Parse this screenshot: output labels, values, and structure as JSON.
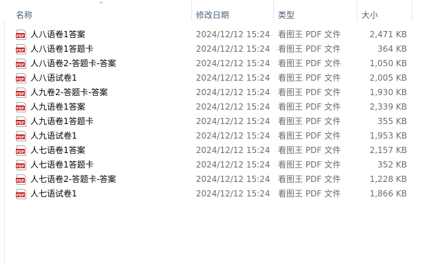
{
  "columns": {
    "name": "名称",
    "date": "修改日期",
    "type": "类型",
    "size": "大小"
  },
  "sort_indicator": "^",
  "file_icon_text": "PDF",
  "files": [
    {
      "name": "人八语卷1答案",
      "date": "2024/12/12 15:24",
      "type": "看图王 PDF 文件",
      "size": "2,471 KB"
    },
    {
      "name": "人八语卷1答题卡",
      "date": "2024/12/12 15:24",
      "type": "看图王 PDF 文件",
      "size": "364 KB"
    },
    {
      "name": "人八语卷2-答题卡-答案",
      "date": "2024/12/12 15:24",
      "type": "看图王 PDF 文件",
      "size": "1,050 KB"
    },
    {
      "name": "人八语试卷1",
      "date": "2024/12/12 15:24",
      "type": "看图王 PDF 文件",
      "size": "2,005 KB"
    },
    {
      "name": "人九卷2-答题卡-答案",
      "date": "2024/12/12 15:24",
      "type": "看图王 PDF 文件",
      "size": "1,930 KB"
    },
    {
      "name": "人九语卷1答案",
      "date": "2024/12/12 15:24",
      "type": "看图王 PDF 文件",
      "size": "2,339 KB"
    },
    {
      "name": "人九语卷1答题卡",
      "date": "2024/12/12 15:24",
      "type": "看图王 PDF 文件",
      "size": "355 KB"
    },
    {
      "name": "人九语试卷1",
      "date": "2024/12/12 15:24",
      "type": "看图王 PDF 文件",
      "size": "1,953 KB"
    },
    {
      "name": "人七语卷1答案",
      "date": "2024/12/12 15:24",
      "type": "看图王 PDF 文件",
      "size": "2,157 KB"
    },
    {
      "name": "人七语卷1答题卡",
      "date": "2024/12/12 15:24",
      "type": "看图王 PDF 文件",
      "size": "352 KB"
    },
    {
      "name": "人七语卷2-答题卡-答案",
      "date": "2024/12/12 15:24",
      "type": "看图王 PDF 文件",
      "size": "1,228 KB"
    },
    {
      "name": "人七语试卷1",
      "date": "2024/12/12 15:24",
      "type": "看图王 PDF 文件",
      "size": "1,866 KB"
    }
  ],
  "colors": {
    "header_text": "#4c607a",
    "icon_red": "#c8201f",
    "meta_text": "#6d6d6d"
  }
}
